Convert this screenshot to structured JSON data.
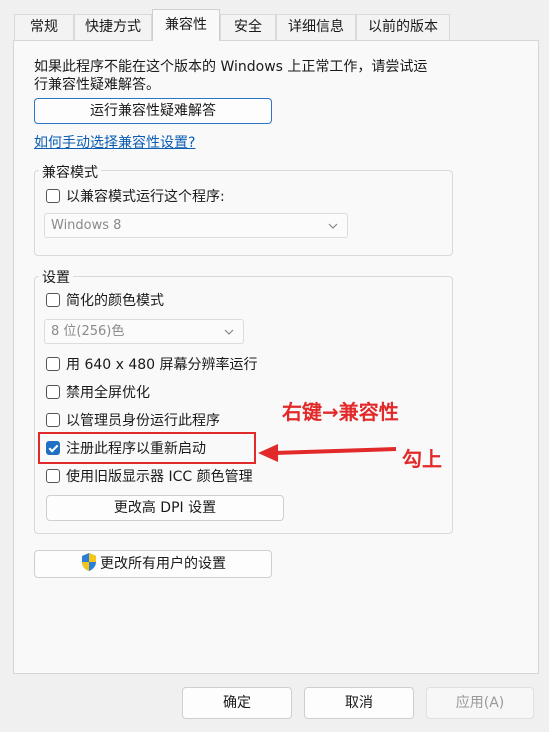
{
  "tabs": [
    "常规",
    "快捷方式",
    "兼容性",
    "安全",
    "详细信息",
    "以前的版本"
  ],
  "active_tab": "兼容性",
  "intro_text_line1": "如果此程序不能在这个版本的 Windows 上正常工作，请尝试运",
  "intro_text_line2": "行兼容性疑难解答。",
  "troubleshoot_button": "运行兼容性疑难解答",
  "manual_link": "如何手动选择兼容性设置?",
  "compat_mode": {
    "title": "兼容模式",
    "checkbox_label": "以兼容模式运行这个程序:",
    "checked": false,
    "select_value": "Windows 8"
  },
  "settings": {
    "title": "设置",
    "reduced_color": {
      "label": "简化的颜色模式",
      "checked": false
    },
    "color_select_value": "8 位(256)色",
    "run_640": {
      "label": "用 640 x 480 屏幕分辨率运行",
      "checked": false
    },
    "disable_fullscreen": {
      "label": "禁用全屏优化",
      "checked": false
    },
    "run_as_admin": {
      "label": "以管理员身份运行此程序",
      "checked": false
    },
    "register_restart": {
      "label": "注册此程序以重新启动",
      "checked": true
    },
    "legacy_icc": {
      "label": "使用旧版显示器 ICC 颜色管理",
      "checked": false
    },
    "dpi_button": "更改高 DPI 设置"
  },
  "all_users_button": "更改所有用户的设置",
  "annotations": {
    "right_click": "右键→兼容性",
    "check": "勾上",
    "color": "#e22a2a"
  },
  "footer": {
    "ok": "确定",
    "cancel": "取消",
    "apply": "应用(A)"
  }
}
